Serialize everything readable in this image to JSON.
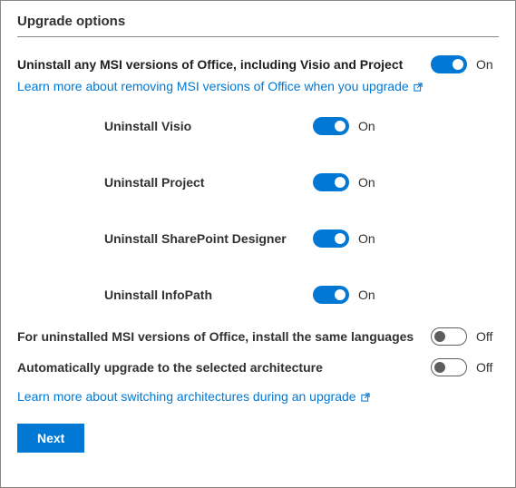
{
  "title": "Upgrade options",
  "main_option": {
    "label": "Uninstall any MSI versions of Office, including Visio and Project",
    "state": "On",
    "on": true
  },
  "link1": "Learn more about removing MSI versions of Office when you upgrade",
  "sub_options": [
    {
      "label": "Uninstall Visio",
      "state": "On",
      "on": true
    },
    {
      "label": "Uninstall Project",
      "state": "On",
      "on": true
    },
    {
      "label": "Uninstall SharePoint Designer",
      "state": "On",
      "on": true
    },
    {
      "label": "Uninstall InfoPath",
      "state": "On",
      "on": true
    }
  ],
  "bottom_options": [
    {
      "label": "For uninstalled MSI versions of Office, install the same languages",
      "state": "Off",
      "on": false
    },
    {
      "label": "Automatically upgrade to the selected architecture",
      "state": "Off",
      "on": false
    }
  ],
  "link2": "Learn more about switching architectures during an upgrade",
  "next_label": "Next"
}
